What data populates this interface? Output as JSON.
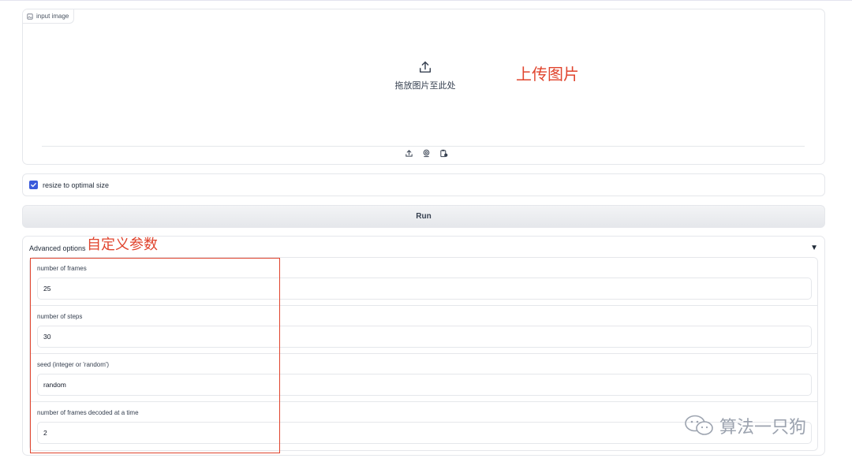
{
  "upload": {
    "label": "input image",
    "drop_text": "拖放图片至此处",
    "annotation": "上传图片",
    "sources": [
      "upload-icon",
      "webcam-icon",
      "clipboard-icon"
    ]
  },
  "resize": {
    "label": "resize to optimal size",
    "checked": true
  },
  "run": {
    "label": "Run"
  },
  "advanced": {
    "title": "Advanced options",
    "caret": "▼",
    "annotation": "自定义参数",
    "fields": [
      {
        "label": "number of frames",
        "value": "25"
      },
      {
        "label": "number of steps",
        "value": "30"
      },
      {
        "label": "seed (integer or 'random')",
        "value": "random"
      },
      {
        "label": "number of frames decoded at a time",
        "value": "2"
      }
    ]
  },
  "watermark": {
    "text": "算法一只狗"
  },
  "colors": {
    "accent": "#3b5bdb",
    "annotation": "#e0442d"
  }
}
